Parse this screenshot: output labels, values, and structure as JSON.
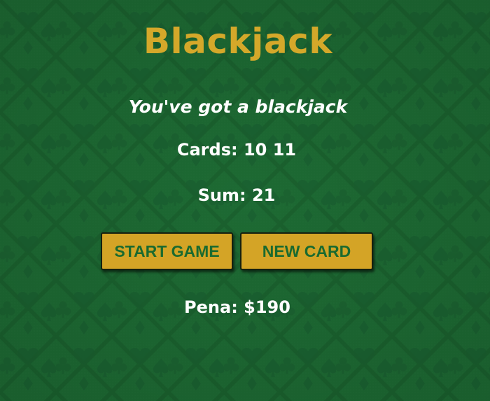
{
  "title": "Blackjack",
  "message": "You've got a blackjack",
  "cards": {
    "label": "Cards:",
    "values": "10 11"
  },
  "sum": {
    "label": "Sum:",
    "value": "21"
  },
  "buttons": {
    "start_label": "START GAME",
    "new_card_label": "NEW CARD"
  },
  "player": {
    "name": "Pena",
    "chips": "$190"
  },
  "colors": {
    "background": "#1d6a33",
    "title": "#d4a82a",
    "button_bg": "#d4a426",
    "button_text": "#1a6a2f",
    "text": "#ffffff"
  },
  "icons": [
    "heart-suit-pattern",
    "club-suit-pattern",
    "spade-suit-pattern",
    "diamond-suit-pattern"
  ]
}
